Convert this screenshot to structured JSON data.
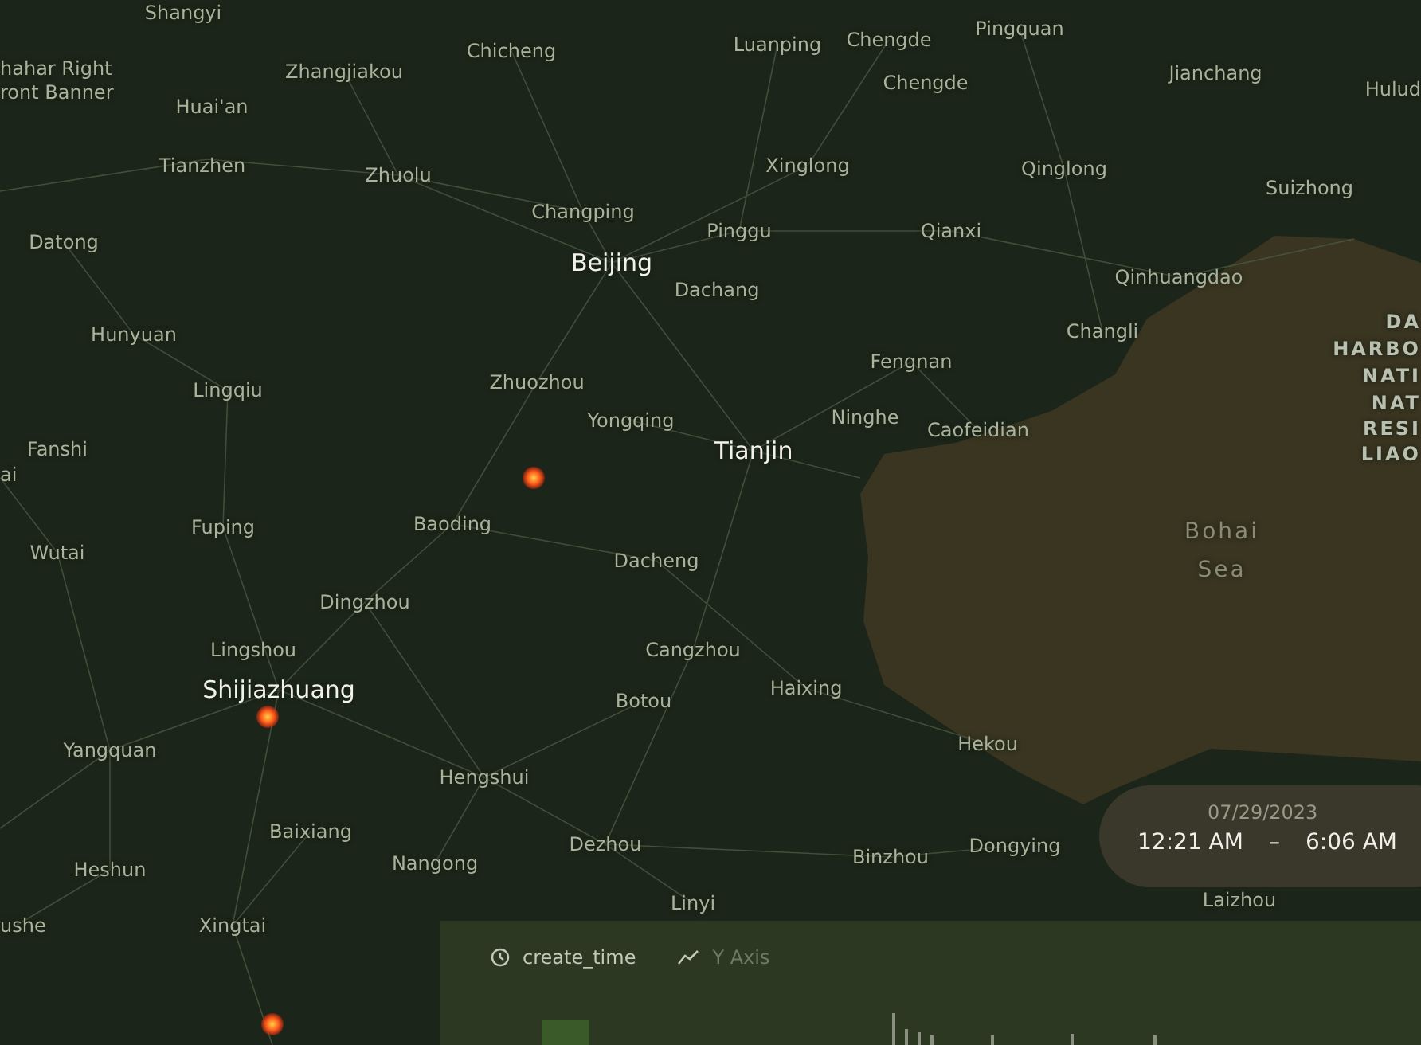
{
  "map": {
    "labels": [
      {
        "text": "Shangyi",
        "kind": "town"
      },
      {
        "text": "Zhangjiakou",
        "kind": "town"
      },
      {
        "text": "Chicheng",
        "kind": "town"
      },
      {
        "text": "Luanping",
        "kind": "town"
      },
      {
        "text": "Chengde",
        "kind": "town"
      },
      {
        "text": "Pingquan",
        "kind": "town"
      },
      {
        "text": "Jianchang",
        "kind": "town"
      },
      {
        "text": "Hulud",
        "kind": "town"
      },
      {
        "text": "hahar Right",
        "kind": "town"
      },
      {
        "text": "ront Banner",
        "kind": "town"
      },
      {
        "text": "Huai'an",
        "kind": "town"
      },
      {
        "text": "Chengde",
        "kind": "town"
      },
      {
        "text": "Tianzhen",
        "kind": "town"
      },
      {
        "text": "Zhuolu",
        "kind": "town"
      },
      {
        "text": "Xinglong",
        "kind": "town"
      },
      {
        "text": "Qinglong",
        "kind": "town"
      },
      {
        "text": "Suizhong",
        "kind": "town"
      },
      {
        "text": "Changping",
        "kind": "town"
      },
      {
        "text": "Datong",
        "kind": "town"
      },
      {
        "text": "Pinggu",
        "kind": "town"
      },
      {
        "text": "Qianxi",
        "kind": "town"
      },
      {
        "text": "Beijing",
        "kind": "city"
      },
      {
        "text": "Qinhuangdao",
        "kind": "town"
      },
      {
        "text": "Dachang",
        "kind": "town"
      },
      {
        "text": "Hunyuan",
        "kind": "town"
      },
      {
        "text": "Changli",
        "kind": "town"
      },
      {
        "text": "Fengnan",
        "kind": "town"
      },
      {
        "text": "Zhuozhou",
        "kind": "town"
      },
      {
        "text": "Lingqiu",
        "kind": "town"
      },
      {
        "text": "Yongqing",
        "kind": "town"
      },
      {
        "text": "Ninghe",
        "kind": "town"
      },
      {
        "text": "Caofeidian",
        "kind": "town"
      },
      {
        "text": "Fanshi",
        "kind": "town"
      },
      {
        "text": "Tianjin",
        "kind": "city"
      },
      {
        "text": "ai",
        "kind": "town"
      },
      {
        "text": "Fuping",
        "kind": "town"
      },
      {
        "text": "Baoding",
        "kind": "town"
      },
      {
        "text": "Bohai",
        "kind": "sea"
      },
      {
        "text": "Wutai",
        "kind": "town"
      },
      {
        "text": "Dacheng",
        "kind": "town"
      },
      {
        "text": "Sea",
        "kind": "sea"
      },
      {
        "text": "Dingzhou",
        "kind": "town"
      },
      {
        "text": "Lingshou",
        "kind": "town"
      },
      {
        "text": "Cangzhou",
        "kind": "town"
      },
      {
        "text": "Haixing",
        "kind": "town"
      },
      {
        "text": "Shijiazhuang",
        "kind": "city"
      },
      {
        "text": "Botou",
        "kind": "town"
      },
      {
        "text": "Hekou",
        "kind": "town"
      },
      {
        "text": "Yangquan",
        "kind": "town"
      },
      {
        "text": "Hengshui",
        "kind": "town"
      },
      {
        "text": "Baixiang",
        "kind": "town"
      },
      {
        "text": "Dezhou",
        "kind": "town"
      },
      {
        "text": "Dongying",
        "kind": "town"
      },
      {
        "text": "Binzhou",
        "kind": "town"
      },
      {
        "text": "Heshun",
        "kind": "town"
      },
      {
        "text": "Nangong",
        "kind": "town"
      },
      {
        "text": "Linyi",
        "kind": "town"
      },
      {
        "text": "Laizhou",
        "kind": "town"
      },
      {
        "text": "Xingtai",
        "kind": "town"
      },
      {
        "text": "ushe",
        "kind": "town"
      },
      {
        "text": "DA",
        "kind": "reserve"
      },
      {
        "text": "HARBO",
        "kind": "reserve"
      },
      {
        "text": "NATI",
        "kind": "reserve"
      },
      {
        "text": "NAT",
        "kind": "reserve"
      },
      {
        "text": "RESI",
        "kind": "reserve"
      },
      {
        "text": "LIAO",
        "kind": "reserve"
      }
    ]
  },
  "time_range": {
    "date": "07/29/2023",
    "start": "12:21 AM",
    "separator": "–",
    "end": "6:06 AM"
  },
  "chart_panel": {
    "x_field": "create_time",
    "y_field": "Y Axis"
  }
}
